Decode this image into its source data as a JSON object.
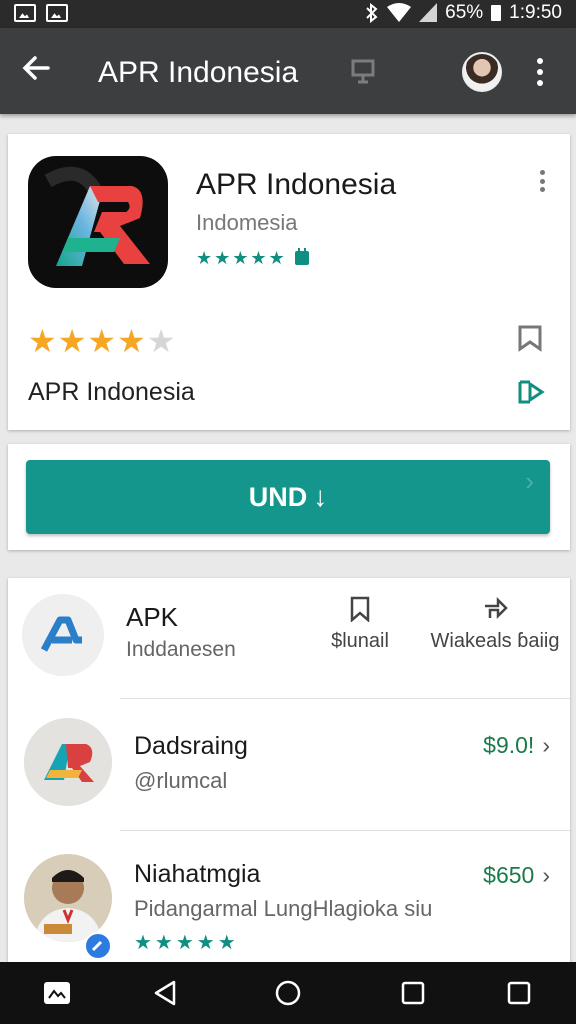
{
  "status_bar": {
    "battery": "65%",
    "time": "1:9:50",
    "icons": [
      "image-icon",
      "image-icon",
      "bluetooth-icon",
      "wifi-icon",
      "signal-icon",
      "battery-icon"
    ]
  },
  "app_bar": {
    "title": "APR Indonesia",
    "icons": [
      "back-arrow-icon",
      "cast-icon",
      "profile-avatar",
      "overflow-menu-icon"
    ]
  },
  "app_card": {
    "name": "APR Indonesia",
    "developer": "Indomesia",
    "small_stars": "★★★★★",
    "rating_stars": 4.5,
    "name_secondary": "APR Indonesia",
    "colors": {
      "star": "#f5a623",
      "accent": "#108f80"
    }
  },
  "install": {
    "label": "UND",
    "icon": "download-icon",
    "color": "#14968d"
  },
  "apk_section": {
    "title": "APK",
    "subtitle": "Inddanesen",
    "actions": [
      {
        "label": "$lunail",
        "icon": "bookmark-icon"
      },
      {
        "label": "Wiakeals ɓaiig",
        "icon": "share-icon"
      }
    ]
  },
  "list": [
    {
      "title": "Dadsraing",
      "subtitle": "@rlumcal",
      "price": "$9.0!",
      "chevron": "›"
    },
    {
      "title": "Niahatmgia",
      "subtitle": "Pidangarmal LungHlagioka siu",
      "price": "$650",
      "chevron": "›",
      "stars": "★★★★★"
    }
  ],
  "nav_bar": {
    "icons": [
      "gallery-icon",
      "back-triangle-icon",
      "home-circle-icon",
      "recents-square-icon",
      "square-icon"
    ]
  }
}
